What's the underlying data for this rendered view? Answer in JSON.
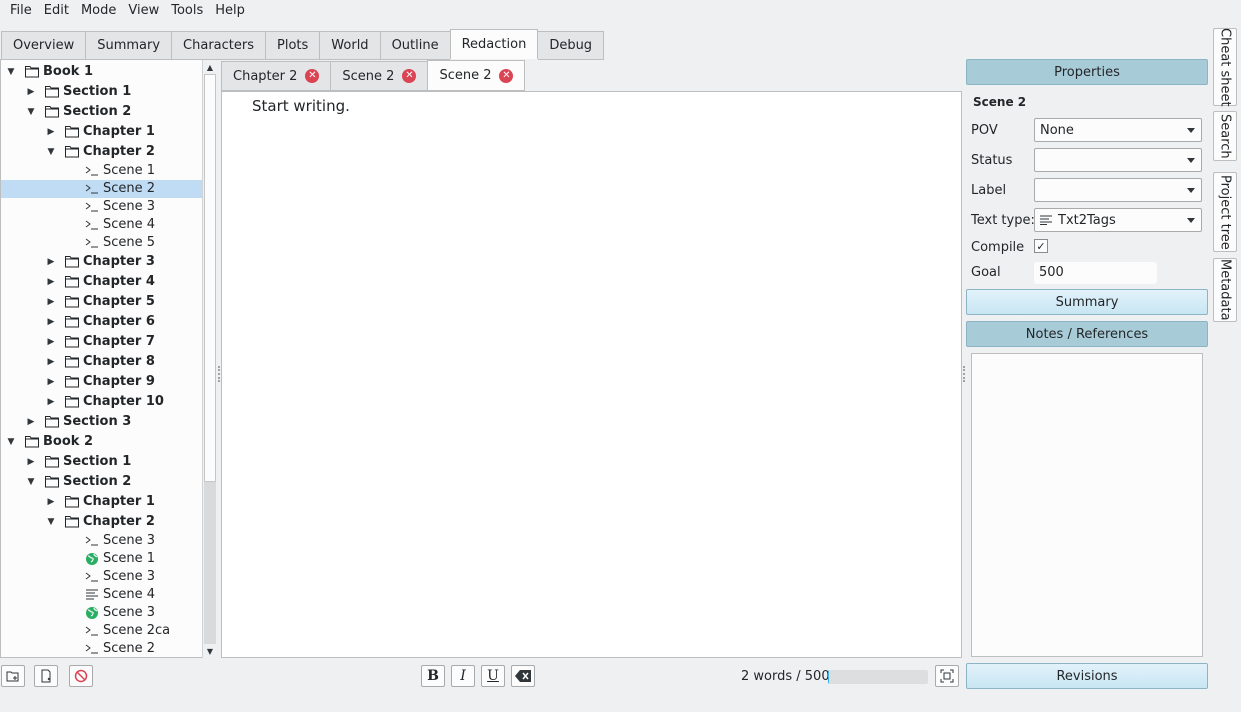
{
  "menu": [
    "File",
    "Edit",
    "Mode",
    "View",
    "Tools",
    "Help"
  ],
  "main_tabs": [
    "Overview",
    "Summary",
    "Characters",
    "Plots",
    "World",
    "Outline",
    "Redaction",
    "Debug"
  ],
  "main_tab_active": "Redaction",
  "tree": [
    {
      "label": "Book 1",
      "level": 0,
      "kind": "folder",
      "arrow": "down"
    },
    {
      "label": "Section 1",
      "level": 1,
      "kind": "folder",
      "arrow": "right"
    },
    {
      "label": "Section 2",
      "level": 1,
      "kind": "folder",
      "arrow": "down"
    },
    {
      "label": "Chapter 1",
      "level": 2,
      "kind": "folder",
      "arrow": "right"
    },
    {
      "label": "Chapter 2",
      "level": 2,
      "kind": "folder",
      "arrow": "down"
    },
    {
      "label": "Scene 1",
      "level": 3,
      "kind": "text"
    },
    {
      "label": "Scene 2",
      "level": 3,
      "kind": "text",
      "selected": true
    },
    {
      "label": "Scene 3",
      "level": 3,
      "kind": "text"
    },
    {
      "label": "Scene 4",
      "level": 3,
      "kind": "text"
    },
    {
      "label": "Scene 5",
      "level": 3,
      "kind": "text"
    },
    {
      "label": "Chapter 3",
      "level": 2,
      "kind": "folder",
      "arrow": "right"
    },
    {
      "label": "Chapter 4",
      "level": 2,
      "kind": "folder",
      "arrow": "right"
    },
    {
      "label": "Chapter 5",
      "level": 2,
      "kind": "folder",
      "arrow": "right"
    },
    {
      "label": "Chapter 6",
      "level": 2,
      "kind": "folder",
      "arrow": "right"
    },
    {
      "label": "Chapter 7",
      "level": 2,
      "kind": "folder",
      "arrow": "right"
    },
    {
      "label": "Chapter 8",
      "level": 2,
      "kind": "folder",
      "arrow": "right"
    },
    {
      "label": "Chapter 9",
      "level": 2,
      "kind": "folder",
      "arrow": "right"
    },
    {
      "label": "Chapter 10",
      "level": 2,
      "kind": "folder",
      "arrow": "right"
    },
    {
      "label": "Section 3",
      "level": 1,
      "kind": "folder",
      "arrow": "right"
    },
    {
      "label": "Book 2",
      "level": 0,
      "kind": "folder",
      "arrow": "down"
    },
    {
      "label": "Section 1",
      "level": 1,
      "kind": "folder",
      "arrow": "right"
    },
    {
      "label": "Section 2",
      "level": 1,
      "kind": "folder",
      "arrow": "down"
    },
    {
      "label": "Chapter 1",
      "level": 2,
      "kind": "folder",
      "arrow": "right"
    },
    {
      "label": "Chapter 2",
      "level": 2,
      "kind": "folder",
      "arrow": "down"
    },
    {
      "label": "Scene 3",
      "level": 3,
      "kind": "text"
    },
    {
      "label": "Scene 1",
      "level": 3,
      "kind": "globe"
    },
    {
      "label": "Scene 3",
      "level": 3,
      "kind": "text"
    },
    {
      "label": "Scene 4",
      "level": 3,
      "kind": "lines"
    },
    {
      "label": "Scene 3",
      "level": 3,
      "kind": "globe"
    },
    {
      "label": "Scene 2ca",
      "level": 3,
      "kind": "text"
    },
    {
      "label": "Scene 2",
      "level": 3,
      "kind": "text"
    }
  ],
  "editor_tabs": [
    "Chapter 2",
    "Scene 2",
    "Scene 2"
  ],
  "editor_placeholder": "Start writing.",
  "word_count_text": "2 words / 500",
  "word_progress": 0.004,
  "format_buttons": [
    "B",
    "I",
    "U"
  ],
  "properties": {
    "header": "Properties",
    "item_title": "Scene 2",
    "pov_label": "POV",
    "pov_value": "None",
    "status_label": "Status",
    "status_value": "",
    "label_label": "Label",
    "label_value": "",
    "text_type_label": "Text type:",
    "text_type_value": "Txt2Tags",
    "compile_label": "Compile",
    "compile_checked": "✓",
    "goal_label": "Goal",
    "goal_value": "500"
  },
  "summary_button": "Summary",
  "notes_button": "Notes / References",
  "revisions_button": "Revisions",
  "side_tabs": [
    "Cheat sheet",
    "Search",
    "Project tree",
    "Metadata"
  ],
  "colors": {
    "accent": "#3daee9",
    "selection": "#bfdcf4",
    "close": "#da4453"
  }
}
